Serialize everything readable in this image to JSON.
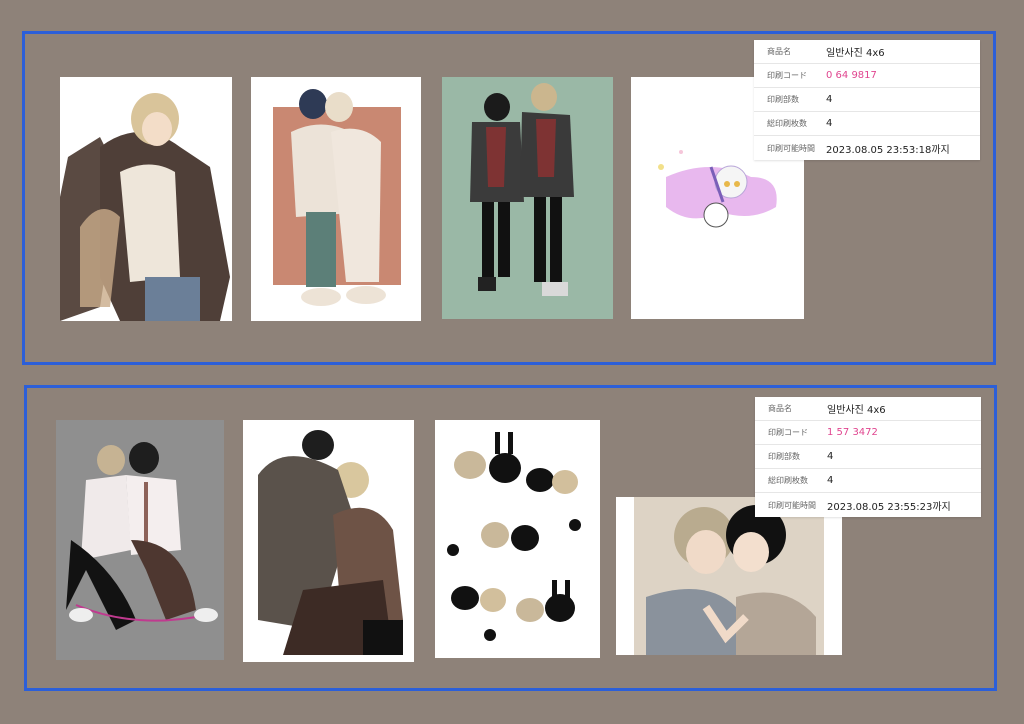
{
  "colors": {
    "background": "#8e8279",
    "panel_border": "#2b5fd9",
    "code_text": "#e0458f"
  },
  "orders": [
    {
      "product_label": "商品名",
      "product_value": "일반사진 4x6",
      "code_label": "印刷コード",
      "code_value": "0 64 9817",
      "copies_label": "印刷部数",
      "copies_value": "4",
      "sheets_label": "総印刷枚数",
      "sheets_value": "4",
      "deadline_label": "印刷可能時間",
      "deadline_value": "2023.08.05 23:53:18까지"
    },
    {
      "product_label": "商品名",
      "product_value": "일반사진 4x6",
      "code_label": "印刷コード",
      "code_value": "1 57 3472",
      "copies_label": "印刷部数",
      "copies_value": "4",
      "sheets_label": "総印刷枚数",
      "sheets_value": "4",
      "deadline_label": "印刷可能時間",
      "deadline_value": "2023.08.05 23:55:23까지"
    }
  ],
  "photos": [
    "illustration-coat-blond",
    "illustration-couple-pink-frame",
    "illustration-students-green",
    "illustration-chibi-lilac",
    "illustration-couple-gray",
    "illustration-hug-white",
    "illustration-chibi-bunnies",
    "illustration-kiss"
  ]
}
